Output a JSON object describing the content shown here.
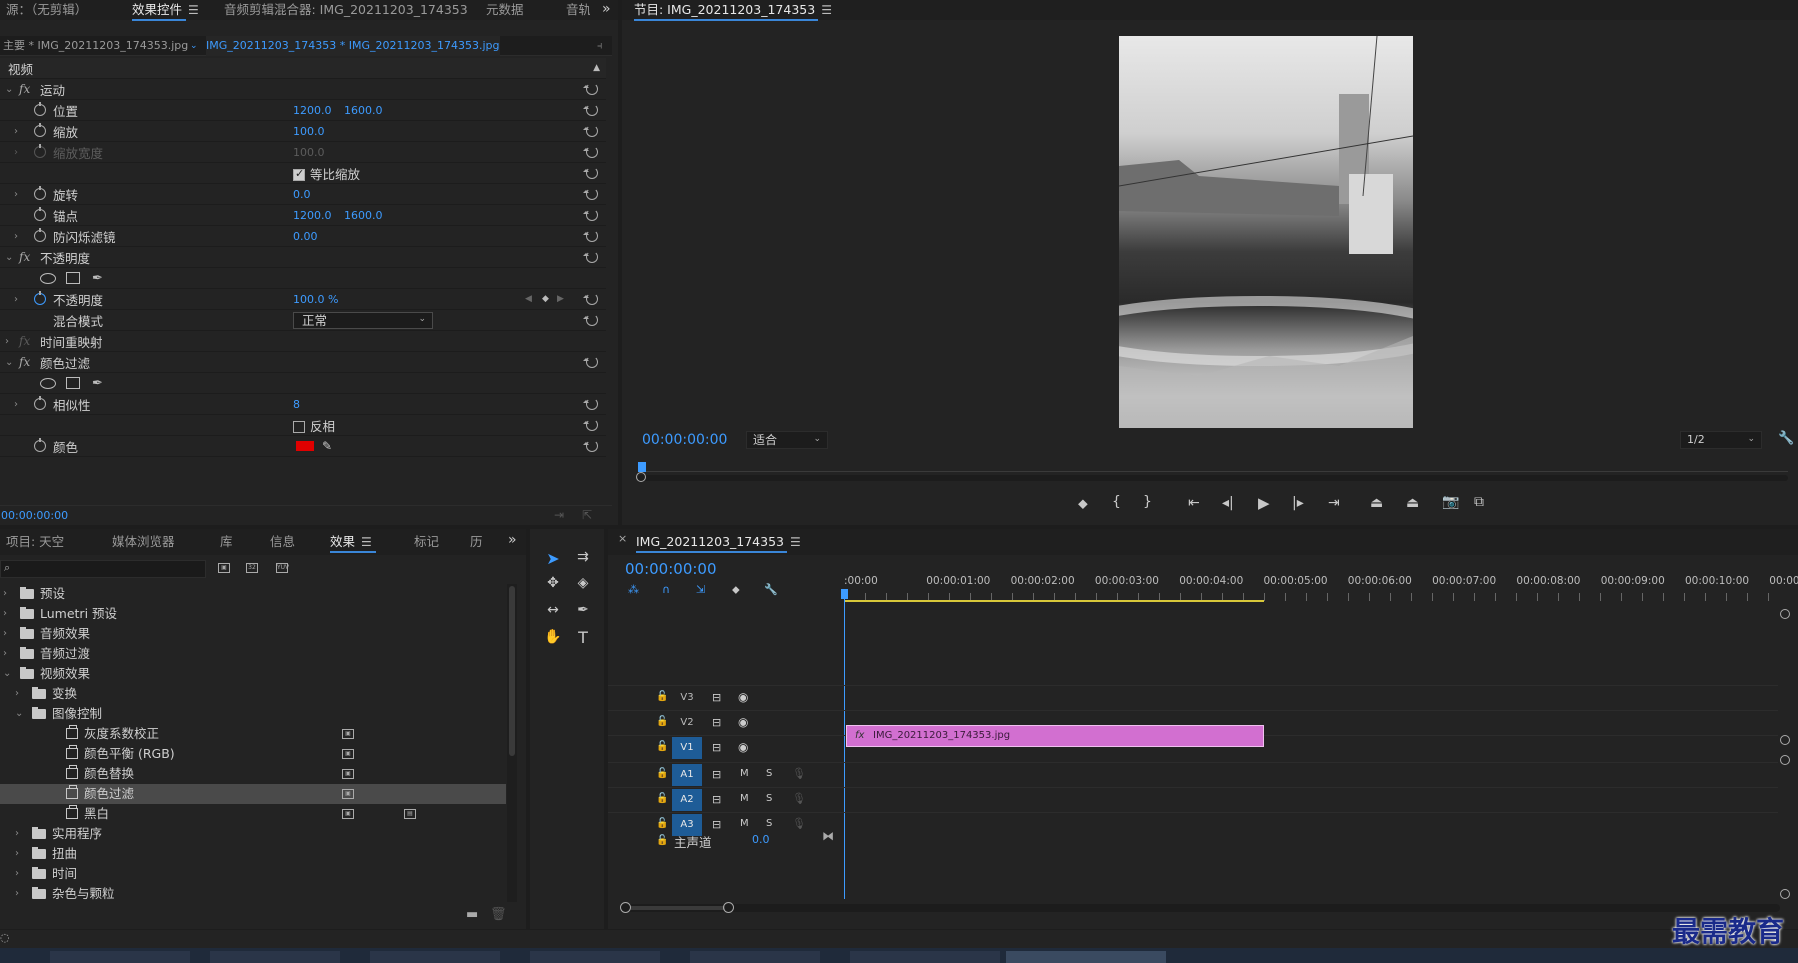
{
  "effect_controls": {
    "tabs": [
      "源：（无剪辑）",
      "效果控件",
      "音频剪辑混合器: IMG_20211203_174353",
      "元数据",
      "音轨"
    ],
    "master_label": "主要 * IMG_20211203_174353.jpg",
    "clip_label": "IMG_20211203_174353 * IMG_20211203_174353.jpg",
    "section": "视频",
    "motion": "运动",
    "position": {
      "label": "位置",
      "x": "1200.0",
      "y": "1600.0"
    },
    "scale": {
      "label": "缩放",
      "value": "100.0"
    },
    "scale_width": {
      "label": "缩放宽度",
      "value": "100.0"
    },
    "uniform_scale": "等比缩放",
    "rotation": {
      "label": "旋转",
      "value": "0.0"
    },
    "anchor": {
      "label": "锚点",
      "x": "1200.0",
      "y": "1600.0"
    },
    "flicker": {
      "label": "防闪烁滤镜",
      "value": "0.00"
    },
    "opacity_section": "不透明度",
    "opacity": {
      "label": "不透明度",
      "value": "100.0 %"
    },
    "blend": {
      "label": "混合模式",
      "value": "正常"
    },
    "time_remap": "时间重映射",
    "color_pass": "颜色过滤",
    "similarity": {
      "label": "相似性",
      "value": "8"
    },
    "invert": "反相",
    "color": "颜色",
    "color_swatch": "#e00000",
    "timecode": "00:00:00:00"
  },
  "program": {
    "title": "节目: IMG_20211203_174353",
    "timecode": "00:00:00:00",
    "fit": "适合",
    "resolution": "1/2"
  },
  "project": {
    "tabs": [
      "项目: 天空",
      "媒体浏览器",
      "库",
      "信息",
      "效果",
      "标记",
      "历"
    ],
    "tree": [
      {
        "label": "预设",
        "level": 0,
        "type": "folder",
        "open": false
      },
      {
        "label": "Lumetri 预设",
        "level": 0,
        "type": "folder",
        "open": false
      },
      {
        "label": "音频效果",
        "level": 0,
        "type": "folder",
        "open": false
      },
      {
        "label": "音频过渡",
        "level": 0,
        "type": "folder",
        "open": false
      },
      {
        "label": "视频效果",
        "level": 0,
        "type": "folder",
        "open": true
      },
      {
        "label": "变换",
        "level": 1,
        "type": "folder",
        "open": false
      },
      {
        "label": "图像控制",
        "level": 1,
        "type": "folder",
        "open": true
      },
      {
        "label": "灰度系数校正",
        "level": 2,
        "type": "fx"
      },
      {
        "label": "颜色平衡 (RGB)",
        "level": 2,
        "type": "fx"
      },
      {
        "label": "颜色替换",
        "level": 2,
        "type": "fx"
      },
      {
        "label": "颜色过滤",
        "level": 2,
        "type": "fx",
        "selected": true
      },
      {
        "label": "黑白",
        "level": 2,
        "type": "fx"
      },
      {
        "label": "实用程序",
        "level": 1,
        "type": "folder",
        "open": false
      },
      {
        "label": "扭曲",
        "level": 1,
        "type": "folder",
        "open": false
      },
      {
        "label": "时间",
        "level": 1,
        "type": "folder",
        "open": false
      },
      {
        "label": "杂色与颗粒",
        "level": 1,
        "type": "folder",
        "open": false
      }
    ]
  },
  "timeline": {
    "title": "IMG_20211203_174353",
    "timecode": "00:00:00:00",
    "ruler": [
      ":00:00",
      "00:00:01:00",
      "00:00:02:00",
      "00:00:03:00",
      "00:00:04:00",
      "00:00:05:00",
      "00:00:06:00",
      "00:00:07:00",
      "00:00:08:00",
      "00:00:09:00",
      "00:00:10:00",
      "00:00:1"
    ],
    "video_tracks": [
      "V3",
      "V2",
      "V1"
    ],
    "audio_tracks": [
      "A1",
      "A2",
      "A3"
    ],
    "master": {
      "label": "主声道",
      "value": "0.0"
    },
    "clip": "IMG_20211203_174353.jpg",
    "m": "M",
    "s": "S"
  },
  "watermark": "最需教育"
}
